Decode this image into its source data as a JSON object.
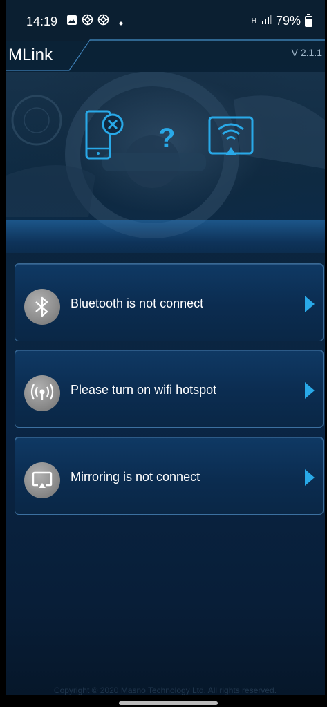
{
  "status_bar": {
    "time": "14:19",
    "network": "H",
    "battery": "79%"
  },
  "header": {
    "title": "MLink",
    "version": "V 2.1.1"
  },
  "hero": {
    "question_mark": "?"
  },
  "items": [
    {
      "label": "Bluetooth is not connect",
      "icon": "bluetooth-icon"
    },
    {
      "label": "Please turn on wifi hotspot",
      "icon": "hotspot-icon"
    },
    {
      "label": "Mirroring is not connect",
      "icon": "mirroring-icon"
    }
  ],
  "footer": {
    "copyright": "Copyright © 2020 Masno Technology Ltd. All rights reserved."
  },
  "colors": {
    "accent": "#29a9e8",
    "card_border": "#5a96c8",
    "background": "#0b253f"
  }
}
